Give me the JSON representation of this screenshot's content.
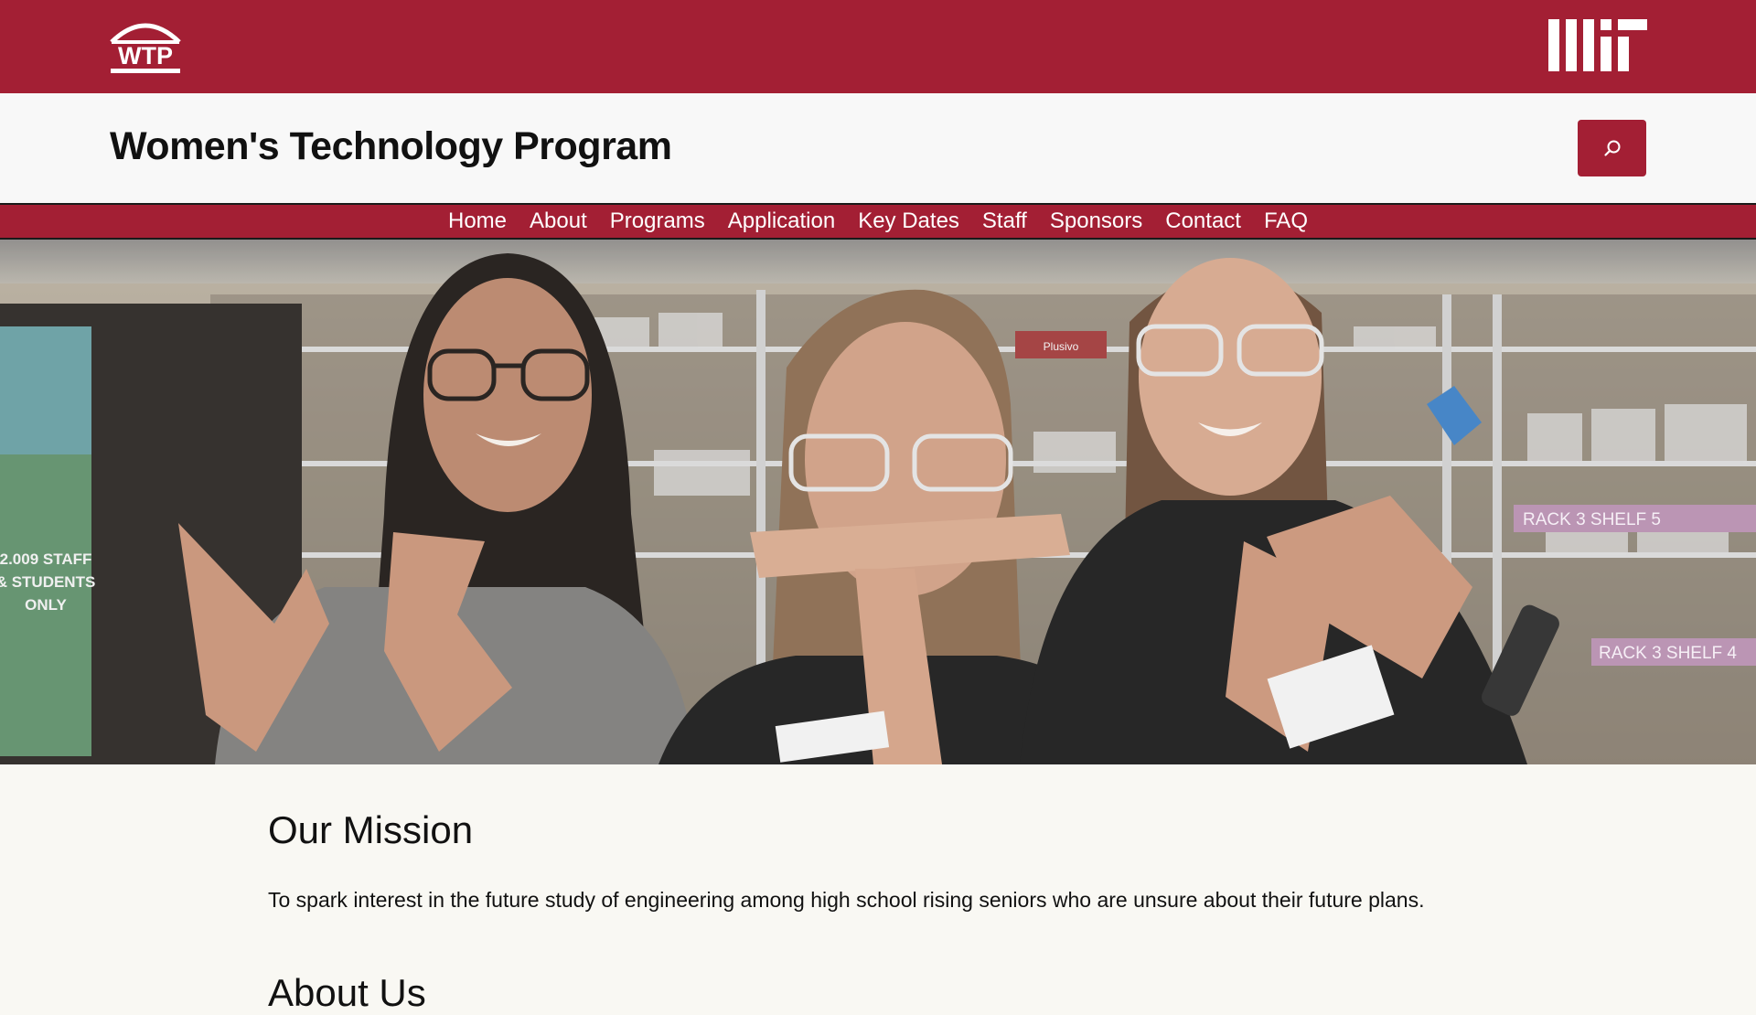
{
  "header": {
    "logo_text": "WTP",
    "mit_logo_alt": "MIT",
    "site_title": "Women's Technology Program",
    "search_aria": "Search"
  },
  "nav": {
    "items": [
      {
        "label": "Home"
      },
      {
        "label": "About"
      },
      {
        "label": "Programs"
      },
      {
        "label": "Application"
      },
      {
        "label": "Key Dates"
      },
      {
        "label": "Staff"
      },
      {
        "label": "Sponsors"
      },
      {
        "label": "Contact"
      },
      {
        "label": "FAQ"
      }
    ]
  },
  "hero": {
    "sign_text_line1": "2.009 STAFF",
    "sign_text_line2": "& STUDENTS",
    "sign_text_line3": "ONLY",
    "shelf_label_1": "RACK 3 SHELF 5",
    "shelf_label_2": "RACK 3 SHELF 4",
    "box_label": "Plusivo"
  },
  "main": {
    "mission_heading": "Our Mission",
    "mission_text": "To spark interest in the future study of engineering among high school rising seniors who are unsure about their future plans.",
    "next_heading": "About Us"
  },
  "colors": {
    "brand_red": "#a31f34",
    "page_bg": "#f9f8f3",
    "title_bg": "#f8f8f8"
  },
  "icons": {
    "search": "search-icon",
    "logo": "wtp-logo-icon",
    "mit": "mit-logo-icon"
  }
}
